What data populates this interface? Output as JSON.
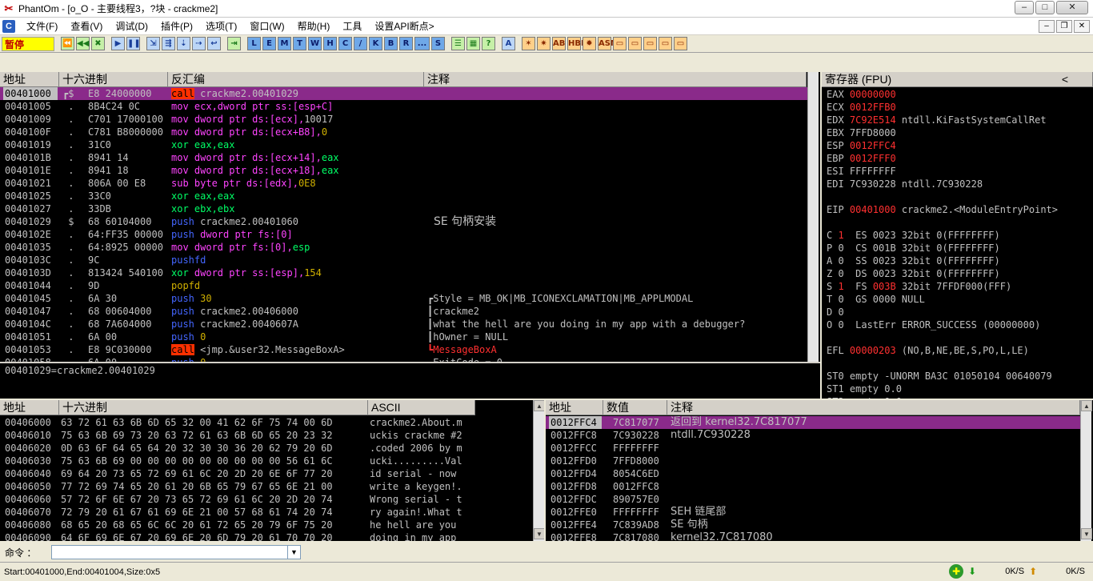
{
  "window": {
    "title": "PhantOm - [o_O - 主要线程3，?块 - crackme2]",
    "min": "–",
    "max": "□",
    "close": "✕"
  },
  "menu": {
    "items": [
      "文件(F)",
      "查看(V)",
      "调试(D)",
      "插件(P)",
      "选项(T)",
      "窗口(W)",
      "帮助(H)",
      "工具",
      "设置API断点>"
    ],
    "mdi": [
      "–",
      "❐",
      "✕"
    ]
  },
  "toolbar": {
    "status": "暂停",
    "group1": [
      "⏪",
      "◀◀",
      "✖"
    ],
    "group2": [
      "▶",
      "❚❚"
    ],
    "group3": [
      "⇲",
      "⇶",
      "⇣",
      "⇢",
      "↩"
    ],
    "group4": [
      "⇥"
    ],
    "letters": [
      "L",
      "E",
      "M",
      "T",
      "W",
      "H",
      "C",
      "/",
      "K",
      "B",
      "R",
      "...",
      "S"
    ],
    "group5": [
      "☰",
      "▦",
      "?"
    ],
    "group6": [
      "A"
    ],
    "group7": [
      "✶",
      "✷",
      "AB",
      "HBP",
      "✹",
      "ASM",
      "▭",
      "▭",
      "▭",
      "▭",
      "▭"
    ]
  },
  "disasm": {
    "headers": {
      "addr": "地址",
      "hex": "十六进制",
      "dis": "反汇编",
      "comment": "注释"
    },
    "rows": [
      {
        "addr": "00401000",
        "mark": "┏$",
        "hex": "E8 24000000",
        "ins": [
          {
            "t": "call",
            "c": "c-call"
          },
          {
            "t": " crackme2.00401029",
            "c": "c-white"
          }
        ],
        "comment": "",
        "ccls": ""
      },
      {
        "addr": "00401005",
        "mark": " .",
        "hex": "8B4C24 0C",
        "ins": [
          {
            "t": "mov ",
            "c": "c-mov"
          },
          {
            "t": "ecx,dword ptr ss:[esp+C]",
            "c": "c-mov"
          }
        ],
        "comment": "",
        "ccls": ""
      },
      {
        "addr": "00401009",
        "mark": " .",
        "hex": "C701 17000100",
        "ins": [
          {
            "t": "mov ",
            "c": "c-mov"
          },
          {
            "t": "dword ptr ds:[ecx],",
            "c": "c-mov"
          },
          {
            "t": "10017",
            "c": "c-white"
          }
        ],
        "comment": "",
        "ccls": ""
      },
      {
        "addr": "0040100F",
        "mark": " .",
        "hex": "C781 B8000000",
        "ins": [
          {
            "t": "mov ",
            "c": "c-mov"
          },
          {
            "t": "dword ptr ds:[ecx+B8],",
            "c": "c-mov"
          },
          {
            "t": "0",
            "c": "c-num"
          }
        ],
        "comment": "",
        "ccls": ""
      },
      {
        "addr": "00401019",
        "mark": " .",
        "hex": "31C0",
        "ins": [
          {
            "t": "xor eax,eax",
            "c": "c-mnem"
          }
        ],
        "comment": "",
        "ccls": ""
      },
      {
        "addr": "0040101B",
        "mark": " .",
        "hex": "8941 14",
        "ins": [
          {
            "t": "mov ",
            "c": "c-mov"
          },
          {
            "t": "dword ptr ds:[ecx+14],",
            "c": "c-mov"
          },
          {
            "t": "eax",
            "c": "c-mnem"
          }
        ],
        "comment": "",
        "ccls": ""
      },
      {
        "addr": "0040101E",
        "mark": " .",
        "hex": "8941 18",
        "ins": [
          {
            "t": "mov ",
            "c": "c-mov"
          },
          {
            "t": "dword ptr ds:[ecx+18],",
            "c": "c-mov"
          },
          {
            "t": "eax",
            "c": "c-mnem"
          }
        ],
        "comment": "",
        "ccls": ""
      },
      {
        "addr": "00401021",
        "mark": " .",
        "hex": "806A 00 E8",
        "ins": [
          {
            "t": "sub byte ptr ds:[edx],",
            "c": "c-mov"
          },
          {
            "t": "0E8",
            "c": "c-num"
          }
        ],
        "comment": "",
        "ccls": ""
      },
      {
        "addr": "00401025",
        "mark": " .",
        "hex": "33C0",
        "ins": [
          {
            "t": "xor eax,eax",
            "c": "c-mnem"
          }
        ],
        "comment": "",
        "ccls": ""
      },
      {
        "addr": "00401027",
        "mark": " .",
        "hex": "33DB",
        "ins": [
          {
            "t": "xor ebx,ebx",
            "c": "c-mnem"
          }
        ],
        "comment": "",
        "ccls": ""
      },
      {
        "addr": "00401029",
        "mark": " $",
        "hex": "68 60104000",
        "ins": [
          {
            "t": "push",
            "c": "c-push"
          },
          {
            "t": " crackme2.00401060",
            "c": "c-white"
          }
        ],
        "comment": "SE 句柄安装",
        "ccls": "c-white"
      },
      {
        "addr": "0040102E",
        "mark": " .",
        "hex": "64:FF35 00000",
        "ins": [
          {
            "t": "push",
            "c": "c-push"
          },
          {
            "t": " dword ptr fs:[0]",
            "c": "c-mov"
          }
        ],
        "comment": "",
        "ccls": ""
      },
      {
        "addr": "00401035",
        "mark": " .",
        "hex": "64:8925 00000",
        "ins": [
          {
            "t": "mov ",
            "c": "c-mov"
          },
          {
            "t": "dword ptr fs:[0],",
            "c": "c-mov"
          },
          {
            "t": "esp",
            "c": "c-mnem"
          }
        ],
        "comment": "",
        "ccls": ""
      },
      {
        "addr": "0040103C",
        "mark": " .",
        "hex": "9C",
        "ins": [
          {
            "t": "pushfd",
            "c": "c-push"
          }
        ],
        "comment": "",
        "ccls": ""
      },
      {
        "addr": "0040103D",
        "mark": " .",
        "hex": "813424 540100",
        "ins": [
          {
            "t": "xor ",
            "c": "c-mnem"
          },
          {
            "t": "dword ptr ss:[esp],",
            "c": "c-mov"
          },
          {
            "t": "154",
            "c": "c-num"
          }
        ],
        "comment": "",
        "ccls": ""
      },
      {
        "addr": "00401044",
        "mark": " .",
        "hex": "9D",
        "ins": [
          {
            "t": "popfd",
            "c": "c-num"
          }
        ],
        "comment": "",
        "ccls": ""
      },
      {
        "addr": "00401045",
        "mark": " .",
        "hex": "6A 30",
        "ins": [
          {
            "t": "push",
            "c": "c-push"
          },
          {
            "t": " 30",
            "c": "c-num"
          }
        ],
        "comment": "┏Style = MB_OK|MB_ICONEXCLAMATION|MB_APPLMODAL",
        "ccls": "c-white"
      },
      {
        "addr": "00401047",
        "mark": " .",
        "hex": "68 00604000",
        "ins": [
          {
            "t": "push",
            "c": "c-push"
          },
          {
            "t": " crackme2.00406000",
            "c": "c-white"
          }
        ],
        "comment": "┃crackme2",
        "ccls": "c-white"
      },
      {
        "addr": "0040104C",
        "mark": " .",
        "hex": "68 7A604000",
        "ins": [
          {
            "t": "push",
            "c": "c-push"
          },
          {
            "t": " crackme2.0040607A",
            "c": "c-white"
          }
        ],
        "comment": "┃what the hell are you doing in my app with a debugger?",
        "ccls": "c-white"
      },
      {
        "addr": "00401051",
        "mark": " .",
        "hex": "6A 00",
        "ins": [
          {
            "t": "push",
            "c": "c-push"
          },
          {
            "t": " 0",
            "c": "c-num"
          }
        ],
        "comment": "┃hOwner = NULL",
        "ccls": "c-white"
      },
      {
        "addr": "00401053",
        "mark": " .",
        "hex": "E8 9C030000",
        "ins": [
          {
            "t": "call",
            "c": "c-call"
          },
          {
            "t": " <jmp.&user32.MessageBoxA>",
            "c": "c-white"
          }
        ],
        "comment": "┗MessageBoxA",
        "ccls": "c-red"
      },
      {
        "addr": "00401058",
        "mark": " .",
        "hex": "6A 00",
        "ins": [
          {
            "t": "push",
            "c": "c-push"
          },
          {
            "t": " 0",
            "c": "c-num"
          }
        ],
        "comment": "┏ExitCode = 0",
        "ccls": "c-white"
      }
    ],
    "info": "00401029=crackme2.00401029"
  },
  "registers": {
    "header": "寄存器 (FPU)",
    "collapse": "<",
    "rows": [
      [
        {
          "t": "EAX ",
          "c": "c-white"
        },
        {
          "t": "00000000",
          "c": "c-red"
        }
      ],
      [
        {
          "t": "ECX ",
          "c": "c-white"
        },
        {
          "t": "0012FFB0",
          "c": "c-red"
        }
      ],
      [
        {
          "t": "EDX ",
          "c": "c-white"
        },
        {
          "t": "7C92E514",
          "c": "c-red"
        },
        {
          "t": " ntdll.KiFastSystemCallRet",
          "c": "c-white"
        }
      ],
      [
        {
          "t": "EBX 7FFD8000",
          "c": "c-white"
        }
      ],
      [
        {
          "t": "ESP ",
          "c": "c-white"
        },
        {
          "t": "0012FFC4",
          "c": "c-red"
        }
      ],
      [
        {
          "t": "EBP ",
          "c": "c-white"
        },
        {
          "t": "0012FFF0",
          "c": "c-red"
        }
      ],
      [
        {
          "t": "ESI FFFFFFFF",
          "c": "c-white"
        }
      ],
      [
        {
          "t": "EDI 7C930228 ntdll.7C930228",
          "c": "c-white"
        }
      ],
      [
        {
          "t": "",
          "c": "c-white"
        }
      ],
      [
        {
          "t": "EIP ",
          "c": "c-white"
        },
        {
          "t": "00401000",
          "c": "c-red"
        },
        {
          "t": " crackme2.<ModuleEntryPoint>",
          "c": "c-white"
        }
      ],
      [
        {
          "t": "",
          "c": "c-white"
        }
      ],
      [
        {
          "t": "C ",
          "c": "c-white"
        },
        {
          "t": "1",
          "c": "c-red"
        },
        {
          "t": "  ES 0023 32bit 0(FFFFFFFF)",
          "c": "c-white"
        }
      ],
      [
        {
          "t": "P 0  CS 001B 32bit 0(FFFFFFFF)",
          "c": "c-white"
        }
      ],
      [
        {
          "t": "A 0  SS 0023 32bit 0(FFFFFFFF)",
          "c": "c-white"
        }
      ],
      [
        {
          "t": "Z 0  DS 0023 32bit 0(FFFFFFFF)",
          "c": "c-white"
        }
      ],
      [
        {
          "t": "S ",
          "c": "c-white"
        },
        {
          "t": "1",
          "c": "c-red"
        },
        {
          "t": "  FS ",
          "c": "c-white"
        },
        {
          "t": "003B",
          "c": "c-red"
        },
        {
          "t": " 32bit 7FFDF000(FFF)",
          "c": "c-white"
        }
      ],
      [
        {
          "t": "T 0  GS 0000 NULL",
          "c": "c-white"
        }
      ],
      [
        {
          "t": "D 0",
          "c": "c-white"
        }
      ],
      [
        {
          "t": "O 0  LastErr ERROR_SUCCESS (00000000)",
          "c": "c-white"
        }
      ],
      [
        {
          "t": "",
          "c": "c-white"
        }
      ],
      [
        {
          "t": "EFL ",
          "c": "c-white"
        },
        {
          "t": "00000203",
          "c": "c-red"
        },
        {
          "t": " (NO,B,NE,BE,S,PO,L,LE)",
          "c": "c-white"
        }
      ],
      [
        {
          "t": "",
          "c": "c-white"
        }
      ],
      [
        {
          "t": "ST0 empty -UNORM BA3C 01050104 00640079",
          "c": "c-white"
        }
      ],
      [
        {
          "t": "ST1 empty 0.0",
          "c": "c-white"
        }
      ],
      [
        {
          "t": "ST2 empty 0.0",
          "c": "c-white"
        }
      ],
      [
        {
          "t": "ST3 empty 0.0",
          "c": "c-white"
        }
      ],
      [
        {
          "t": "ST4 empty 0.0",
          "c": "c-white"
        }
      ]
    ]
  },
  "dump": {
    "headers": {
      "addr": "地址",
      "hex": "十六进制",
      "ascii": "ASCII"
    },
    "rows": [
      {
        "addr": "00406000",
        "hex": "63 72 61 63 6B 6D 65 32 00 41 62 6F 75 74 00 6D",
        "ascii": "crackme2.About.m"
      },
      {
        "addr": "00406010",
        "hex": "75 63 6B 69 73 20 63 72 61 63 6B 6D 65 20 23 32",
        "ascii": "uckis crackme #2"
      },
      {
        "addr": "00406020",
        "hex": "0D 63 6F 64 65 64 20 32 30 30 36 20 62 79 20 6D",
        "ascii": ".coded 2006 by m"
      },
      {
        "addr": "00406030",
        "hex": "75 63 6B 69 00 00 00 00 00 00 00 00 00 56 61 6C",
        "ascii": "ucki.........Val"
      },
      {
        "addr": "00406040",
        "hex": "69 64 20 73 65 72 69 61 6C 20 2D 20 6E 6F 77 20",
        "ascii": "id serial - now "
      },
      {
        "addr": "00406050",
        "hex": "77 72 69 74 65 20 61 20 6B 65 79 67 65 6E 21 00",
        "ascii": "write a keygen!."
      },
      {
        "addr": "00406060",
        "hex": "57 72 6F 6E 67 20 73 65 72 69 61 6C 20 2D 20 74",
        "ascii": "Wrong serial - t"
      },
      {
        "addr": "00406070",
        "hex": "72 79 20 61 67 61 69 6E 21 00 57 68 61 74 20 74",
        "ascii": "ry again!.What t"
      },
      {
        "addr": "00406080",
        "hex": "68 65 20 68 65 6C 6C 20 61 72 65 20 79 6F 75 20",
        "ascii": "he hell are you "
      },
      {
        "addr": "00406090",
        "hex": "64 6F 69 6E 67 20 69 6E 20 6D 79 20 61 70 70 20",
        "ascii": "doing in my app "
      }
    ]
  },
  "stack": {
    "headers": {
      "addr": "地址",
      "val": "数值",
      "comment": "注释"
    },
    "rows": [
      {
        "addr": "0012FFC4",
        "val": "7C817077",
        "comment": "返回到 kernel32.7C817077"
      },
      {
        "addr": "0012FFC8",
        "val": "7C930228",
        "comment": "ntdll.7C930228"
      },
      {
        "addr": "0012FFCC",
        "val": "FFFFFFFF",
        "comment": ""
      },
      {
        "addr": "0012FFD0",
        "val": "7FFD8000",
        "comment": ""
      },
      {
        "addr": "0012FFD4",
        "val": "8054C6ED",
        "comment": ""
      },
      {
        "addr": "0012FFD8",
        "val": "0012FFC8",
        "comment": ""
      },
      {
        "addr": "0012FFDC",
        "val": "890757E0",
        "comment": ""
      },
      {
        "addr": "0012FFE0",
        "val": "FFFFFFFF",
        "comment": "SEH 链尾部"
      },
      {
        "addr": "0012FFE4",
        "val": "7C839AD8",
        "comment": "SE 句柄"
      },
      {
        "addr": "0012FFE8",
        "val": "7C817080",
        "comment": "kernel32.7C817080"
      }
    ]
  },
  "command": {
    "label": "命令 ：",
    "value": ""
  },
  "status": {
    "text": "Start:00401000,End:00401004,Size:0x5",
    "down": "0K/S",
    "up": "0K/S"
  },
  "colors": {
    "selection": "#8a2a8a",
    "register_changed": "#ff3030",
    "mnemonic_green": "#00ff66",
    "mov_magenta": "#ff44ff",
    "push_blue": "#4466ff",
    "call_bg": "#ff3000"
  }
}
